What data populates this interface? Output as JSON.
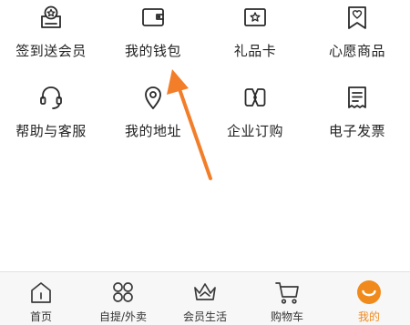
{
  "grid": {
    "items": [
      {
        "label": "签到送会员",
        "icon": "sign-in-gift-icon"
      },
      {
        "label": "我的钱包",
        "icon": "wallet-icon"
      },
      {
        "label": "礼品卡",
        "icon": "gift-card-icon"
      },
      {
        "label": "心愿商品",
        "icon": "wishlist-icon"
      },
      {
        "label": "帮助与客服",
        "icon": "headset-icon"
      },
      {
        "label": "我的地址",
        "icon": "location-pin-icon"
      },
      {
        "label": "企业订购",
        "icon": "enterprise-icon"
      },
      {
        "label": "电子发票",
        "icon": "invoice-icon"
      }
    ]
  },
  "annotation": {
    "arrow_color": "#f27e2a",
    "points_to": "我的钱包"
  },
  "tabbar": {
    "tabs": [
      {
        "label": "首页",
        "icon": "home-icon",
        "active": false
      },
      {
        "label": "自提/外卖",
        "icon": "four-dots-icon",
        "active": false
      },
      {
        "label": "会员生活",
        "icon": "crown-icon",
        "active": false
      },
      {
        "label": "购物车",
        "icon": "cart-icon",
        "active": false
      },
      {
        "label": "我的",
        "icon": "smile-face-icon",
        "active": true
      }
    ]
  },
  "colors": {
    "accent": "#f08a1c",
    "text": "#222222",
    "tabbar_bg": "#f7f7f7"
  }
}
